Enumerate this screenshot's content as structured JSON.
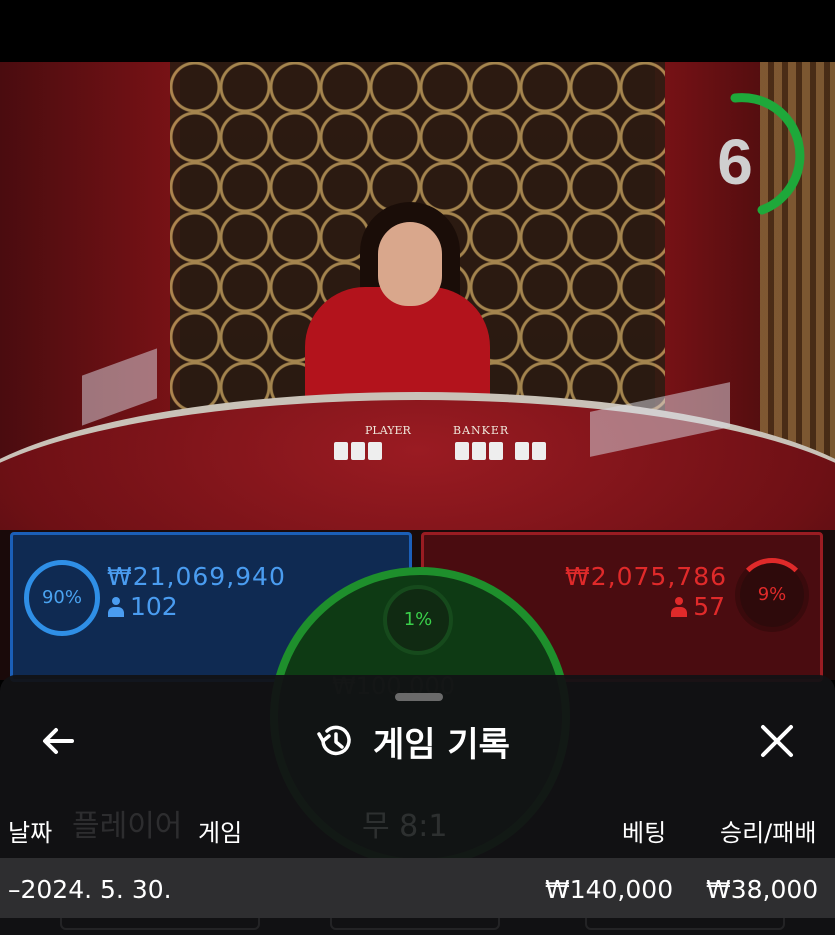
{
  "video": {
    "timer": "6",
    "table_labels": {
      "player": "PLAYER",
      "banker": "BANKER"
    }
  },
  "bets": {
    "player": {
      "percent": "90%",
      "amount": "₩21,069,940",
      "players": "102",
      "color": "#4a9cf0"
    },
    "banker": {
      "percent": "9%",
      "amount": "₩2,075,786",
      "players": "57",
      "color": "#e02a2a"
    },
    "tie": {
      "percent": "1%",
      "color": "#1e8f2c"
    }
  },
  "history_panel": {
    "title": "게임 기록",
    "back_icon": "arrow-left-icon",
    "history_icon": "history-icon",
    "close_icon": "close-icon",
    "columns": {
      "date": "날짜",
      "game": "게임",
      "bet": "베팅",
      "result": "승리/패배"
    },
    "rows": [
      {
        "date": "2024. 5. 30.",
        "game": "",
        "bet": "₩140,000",
        "result": "₩38,000"
      }
    ],
    "background_ghost": {
      "player_label": "플레이어",
      "tie_label": "무 8:1"
    }
  }
}
